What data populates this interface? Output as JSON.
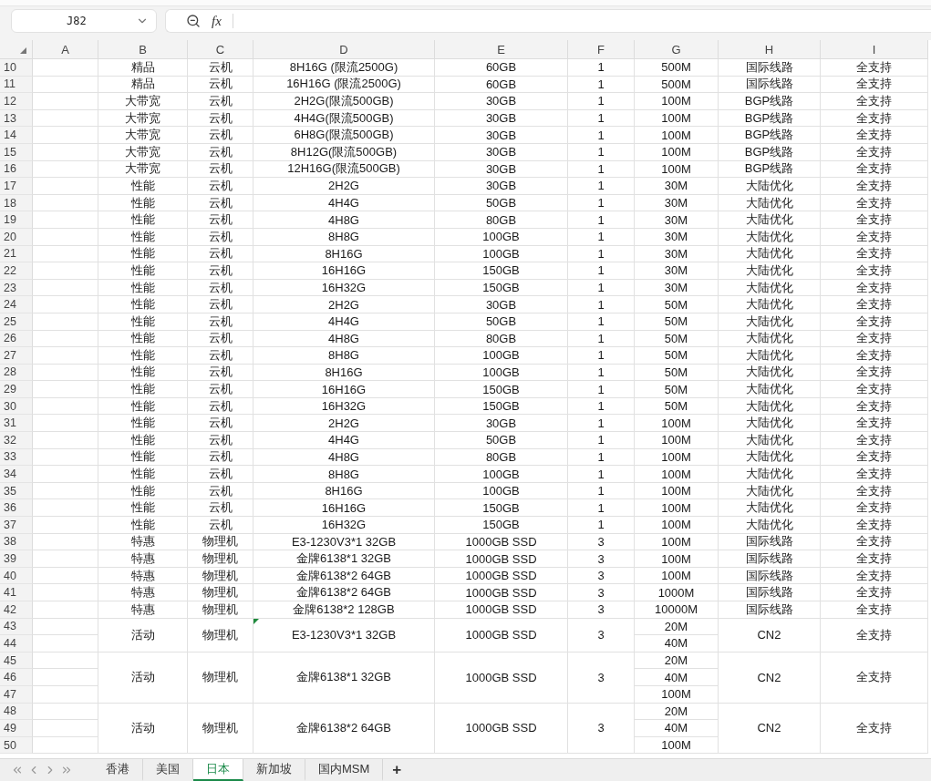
{
  "name_box": {
    "value": "J82"
  },
  "formula_bar": {
    "fx_label": "fx"
  },
  "columns": [
    "A",
    "B",
    "C",
    "D",
    "E",
    "F",
    "G",
    "H",
    "I"
  ],
  "rows": [
    {
      "row": "10",
      "cells": [
        "精品",
        "云机",
        "8H16G (限流2500G)",
        "60GB",
        "1",
        "500M",
        "国际线路",
        "全支持"
      ]
    },
    {
      "row": "11",
      "cells": [
        "精品",
        "云机",
        "16H16G (限流2500G)",
        "60GB",
        "1",
        "500M",
        "国际线路",
        "全支持"
      ]
    },
    {
      "row": "12",
      "cells": [
        "大带宽",
        "云机",
        "2H2G(限流500GB)",
        "30GB",
        "1",
        "100M",
        "BGP线路",
        "全支持"
      ]
    },
    {
      "row": "13",
      "cells": [
        "大带宽",
        "云机",
        "4H4G(限流500GB)",
        "30GB",
        "1",
        "100M",
        "BGP线路",
        "全支持"
      ]
    },
    {
      "row": "14",
      "cells": [
        "大带宽",
        "云机",
        "6H8G(限流500GB)",
        "30GB",
        "1",
        "100M",
        "BGP线路",
        "全支持"
      ]
    },
    {
      "row": "15",
      "cells": [
        "大带宽",
        "云机",
        "8H12G(限流500GB)",
        "30GB",
        "1",
        "100M",
        "BGP线路",
        "全支持"
      ]
    },
    {
      "row": "16",
      "cells": [
        "大带宽",
        "云机",
        "12H16G(限流500GB)",
        "30GB",
        "1",
        "100M",
        "BGP线路",
        "全支持"
      ]
    },
    {
      "row": "17",
      "cells": [
        "性能",
        "云机",
        "2H2G",
        "30GB",
        "1",
        "30M",
        "大陆优化",
        "全支持"
      ]
    },
    {
      "row": "18",
      "cells": [
        "性能",
        "云机",
        "4H4G",
        "50GB",
        "1",
        "30M",
        "大陆优化",
        "全支持"
      ]
    },
    {
      "row": "19",
      "cells": [
        "性能",
        "云机",
        "4H8G",
        "80GB",
        "1",
        "30M",
        "大陆优化",
        "全支持"
      ]
    },
    {
      "row": "20",
      "cells": [
        "性能",
        "云机",
        "8H8G",
        "100GB",
        "1",
        "30M",
        "大陆优化",
        "全支持"
      ]
    },
    {
      "row": "21",
      "cells": [
        "性能",
        "云机",
        "8H16G",
        "100GB",
        "1",
        "30M",
        "大陆优化",
        "全支持"
      ]
    },
    {
      "row": "22",
      "cells": [
        "性能",
        "云机",
        "16H16G",
        "150GB",
        "1",
        "30M",
        "大陆优化",
        "全支持"
      ]
    },
    {
      "row": "23",
      "cells": [
        "性能",
        "云机",
        "16H32G",
        "150GB",
        "1",
        "30M",
        "大陆优化",
        "全支持"
      ]
    },
    {
      "row": "24",
      "cells": [
        "性能",
        "云机",
        "2H2G",
        "30GB",
        "1",
        "50M",
        "大陆优化",
        "全支持"
      ]
    },
    {
      "row": "25",
      "cells": [
        "性能",
        "云机",
        "4H4G",
        "50GB",
        "1",
        "50M",
        "大陆优化",
        "全支持"
      ]
    },
    {
      "row": "26",
      "cells": [
        "性能",
        "云机",
        "4H8G",
        "80GB",
        "1",
        "50M",
        "大陆优化",
        "全支持"
      ]
    },
    {
      "row": "27",
      "cells": [
        "性能",
        "云机",
        "8H8G",
        "100GB",
        "1",
        "50M",
        "大陆优化",
        "全支持"
      ]
    },
    {
      "row": "28",
      "cells": [
        "性能",
        "云机",
        "8H16G",
        "100GB",
        "1",
        "50M",
        "大陆优化",
        "全支持"
      ]
    },
    {
      "row": "29",
      "cells": [
        "性能",
        "云机",
        "16H16G",
        "150GB",
        "1",
        "50M",
        "大陆优化",
        "全支持"
      ]
    },
    {
      "row": "30",
      "cells": [
        "性能",
        "云机",
        "16H32G",
        "150GB",
        "1",
        "50M",
        "大陆优化",
        "全支持"
      ]
    },
    {
      "row": "31",
      "cells": [
        "性能",
        "云机",
        "2H2G",
        "30GB",
        "1",
        "100M",
        "大陆优化",
        "全支持"
      ]
    },
    {
      "row": "32",
      "cells": [
        "性能",
        "云机",
        "4H4G",
        "50GB",
        "1",
        "100M",
        "大陆优化",
        "全支持"
      ]
    },
    {
      "row": "33",
      "cells": [
        "性能",
        "云机",
        "4H8G",
        "80GB",
        "1",
        "100M",
        "大陆优化",
        "全支持"
      ]
    },
    {
      "row": "34",
      "cells": [
        "性能",
        "云机",
        "8H8G",
        "100GB",
        "1",
        "100M",
        "大陆优化",
        "全支持"
      ]
    },
    {
      "row": "35",
      "cells": [
        "性能",
        "云机",
        "8H16G",
        "100GB",
        "1",
        "100M",
        "大陆优化",
        "全支持"
      ]
    },
    {
      "row": "36",
      "cells": [
        "性能",
        "云机",
        "16H16G",
        "150GB",
        "1",
        "100M",
        "大陆优化",
        "全支持"
      ]
    },
    {
      "row": "37",
      "cells": [
        "性能",
        "云机",
        "16H32G",
        "150GB",
        "1",
        "100M",
        "大陆优化",
        "全支持"
      ]
    },
    {
      "row": "38",
      "cells": [
        "特惠",
        "物理机",
        "E3-1230V3*1 32GB",
        "1000GB SSD",
        "3",
        "100M",
        "国际线路",
        "全支持"
      ]
    },
    {
      "row": "39",
      "cells": [
        "特惠",
        "物理机",
        "金牌6138*1 32GB",
        "1000GB SSD",
        "3",
        "100M",
        "国际线路",
        "全支持"
      ]
    },
    {
      "row": "40",
      "cells": [
        "特惠",
        "物理机",
        "金牌6138*2 64GB",
        "1000GB SSD",
        "3",
        "100M",
        "国际线路",
        "全支持"
      ]
    },
    {
      "row": "41",
      "cells": [
        "特惠",
        "物理机",
        "金牌6138*2 64GB",
        "1000GB SSD",
        "3",
        "1000M",
        "国际线路",
        "全支持"
      ]
    },
    {
      "row": "42",
      "cells": [
        "特惠",
        "物理机",
        "金牌6138*2 128GB",
        "1000GB SSD",
        "3",
        "10000M",
        "国际线路",
        "全支持"
      ]
    }
  ],
  "merged_groups": [
    {
      "rows": [
        "43",
        "44"
      ],
      "category": "活动",
      "type": "物理机",
      "spec": "E3-1230V3*1 32GB",
      "disk": "1000GB SSD",
      "count": "3",
      "bandwidths": [
        "20M",
        "40M"
      ],
      "line": "CN2",
      "support": "全支持",
      "comment_mark": true
    },
    {
      "rows": [
        "45",
        "46",
        "47"
      ],
      "category": "活动",
      "type": "物理机",
      "spec": "金牌6138*1 32GB",
      "disk": "1000GB SSD",
      "count": "3",
      "bandwidths": [
        "20M",
        "40M",
        "100M"
      ],
      "line": "CN2",
      "support": "全支持",
      "comment_mark": false
    },
    {
      "rows": [
        "48",
        "49",
        "50"
      ],
      "category": "活动",
      "type": "物理机",
      "spec": "金牌6138*2 64GB",
      "disk": "1000GB SSD",
      "count": "3",
      "bandwidths": [
        "20M",
        "40M",
        "100M"
      ],
      "line": "CN2",
      "support": "全支持",
      "comment_mark": false
    }
  ],
  "sheet_tabs": [
    {
      "label": "香港",
      "selected": false
    },
    {
      "label": "美国",
      "selected": false
    },
    {
      "label": "日本",
      "selected": true
    },
    {
      "label": "新加坡",
      "selected": false
    },
    {
      "label": "国内MSM",
      "selected": false
    }
  ],
  "add_sheet": "+"
}
